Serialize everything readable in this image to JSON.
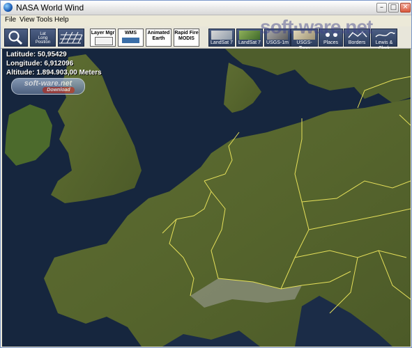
{
  "window": {
    "title": "NASA World Wind",
    "minimize": "–",
    "maximize": "□",
    "close": "✕"
  },
  "menu": [
    "File",
    "View",
    "Tools",
    "Help"
  ],
  "toolbar": {
    "left_buttons": [
      {
        "name": "search",
        "icon": "magnifier-icon"
      },
      {
        "name": "position",
        "lines": [
          "Lat",
          "Long",
          "Position"
        ]
      },
      {
        "name": "grid",
        "icon": "grid-icon"
      }
    ],
    "mid_buttons": [
      {
        "name": "layer-manager",
        "label": "Layer Mgr"
      },
      {
        "name": "wms",
        "label": "WMS"
      },
      {
        "name": "animated-earth",
        "label": "Animated Earth"
      },
      {
        "name": "rapid-fire-modis",
        "label": "Rapid Fire MODIS"
      }
    ],
    "layer_buttons": [
      {
        "name": "landsat-7-visible",
        "label": "LandSat 7"
      },
      {
        "name": "landsat-7-pseudo",
        "label": "LandSat 7"
      },
      {
        "name": "usgs-1m",
        "label": "USGS-1m"
      },
      {
        "name": "usgs-topo",
        "label": "USGS-Topo"
      },
      {
        "name": "places",
        "label": "Places"
      },
      {
        "name": "borders",
        "label": "Borders"
      },
      {
        "name": "lewis-clark",
        "label": "Lewis & Clark"
      }
    ]
  },
  "readout": {
    "latitude": "Latitude: 50,95429",
    "longitude": "Longitude: 6,912096",
    "altitude": "Altitude: 1.894.903,00 Meters"
  },
  "watermark": {
    "small": "soft-ware.net",
    "small_sub": "Download",
    "large": "soft·ware.net"
  },
  "colors": {
    "ocean": "#15243b",
    "land": "#5a6a30",
    "border": "#e6e05a",
    "toolbar_dark": "#33456a"
  }
}
